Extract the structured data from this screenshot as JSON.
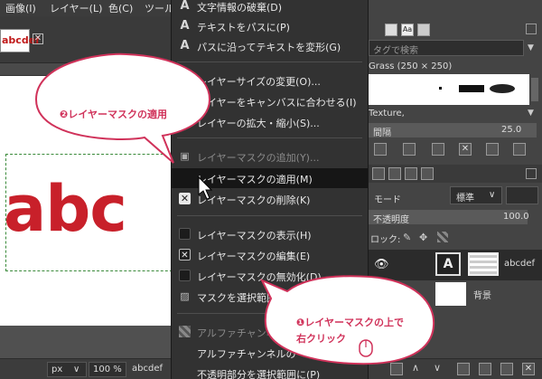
{
  "menubar": {
    "items": [
      "画像(I)",
      "レイヤー(L)",
      "色(C)",
      "ツール"
    ]
  },
  "tab": {
    "thumbnail_text": "abcdef",
    "close_label": "✕"
  },
  "canvas": {
    "text": "abc"
  },
  "context_menu": {
    "items": [
      {
        "label": "文字情報の破棄(D)",
        "icon": "text-A-icon",
        "enabled": true
      },
      {
        "label": "テキストをパスに(P)",
        "icon": "text-A-icon",
        "enabled": true
      },
      {
        "label": "パスに沿ってテキストを変形(G)",
        "icon": "text-A-icon",
        "enabled": true
      },
      {
        "label": "レイヤーサイズの変更(O)...",
        "icon": "none",
        "enabled": true
      },
      {
        "label": "レイヤーをキャンバスに合わせる(I)",
        "icon": "none",
        "enabled": true
      },
      {
        "label": "レイヤーの拡大・縮小(S)...",
        "icon": "none",
        "enabled": true
      },
      {
        "label": "レイヤーマスクの追加(Y)...",
        "icon": "add-mask-icon",
        "enabled": false
      },
      {
        "label": "レイヤーマスクの適用(M)",
        "icon": "none",
        "enabled": true
      },
      {
        "label": "レイヤーマスクの削除(K)",
        "icon": "delete-mask-icon",
        "enabled": true
      },
      {
        "label": "レイヤーマスクの表示(H)",
        "icon": "checkbox-icon",
        "enabled": true
      },
      {
        "label": "レイヤーマスクの編集(E)",
        "icon": "checkbox-checked-icon",
        "enabled": true
      },
      {
        "label": "レイヤーマスクの無効化(D)",
        "icon": "checkbox-icon",
        "enabled": true
      },
      {
        "label": "マスクを選択範囲に",
        "icon": "mask-to-selection-icon",
        "enabled": true
      },
      {
        "label": "アルファチャンネルの",
        "icon": "alpha-icon",
        "enabled": false
      },
      {
        "label": "アルファチャンネルの",
        "icon": "none",
        "enabled": true
      },
      {
        "label": "不透明部分を選択範囲に(P)",
        "icon": "none",
        "enabled": true
      }
    ]
  },
  "dock": {
    "tag_search_placeholder": "タグで検索",
    "brush_name": "Grass (250 × 250)",
    "pattern_name": "Texture,",
    "spacing_label": "間隔",
    "spacing_value": "25.0",
    "mode_label": "モード",
    "mode_value": "標準",
    "opacity_label": "不透明度",
    "opacity_value": "100.0",
    "lock_label": "ロック:",
    "layers": [
      {
        "name": "abcdef"
      },
      {
        "name": "背景"
      }
    ]
  },
  "statusbar": {
    "unit": "px",
    "zoom": "100 %",
    "layer_name": "abcdef"
  },
  "callouts": {
    "top": "❷レイヤーマスクの適用",
    "bottom_line1": "❶レイヤーマスクの上で",
    "bottom_line2": "右クリック"
  },
  "colors": {
    "accent_pink": "#d0325a",
    "canvas_text": "#c8202a"
  }
}
